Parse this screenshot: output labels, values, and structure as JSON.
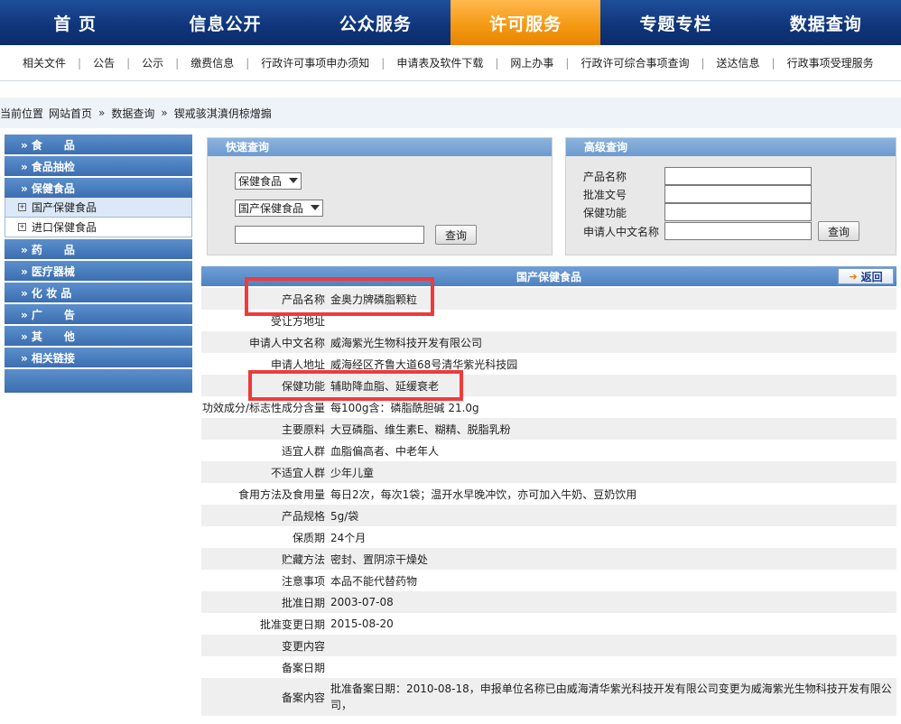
{
  "topnav": [
    {
      "label": "首 页",
      "active": false
    },
    {
      "label": "信息公开",
      "active": false
    },
    {
      "label": "公众服务",
      "active": false
    },
    {
      "label": "许可服务",
      "active": true
    },
    {
      "label": "专题专栏",
      "active": false
    },
    {
      "label": "数据查询",
      "active": false
    }
  ],
  "subnav": [
    "相关文件",
    "公告",
    "公示",
    "缴费信息",
    "行政许可事项申办须知",
    "申请表及软件下载",
    "网上办事",
    "行政许可综合事项查询",
    "送达信息",
    "行政事项受理服务"
  ],
  "breadcrumb": {
    "prefix": "当前位置",
    "items": [
      "网站首页",
      "数据查询",
      "锲戒骇淇濆仴椋熷搧"
    ]
  },
  "sidebar": {
    "items": [
      {
        "label": "» 食　　品",
        "type": "cat"
      },
      {
        "label": "» 食品抽检",
        "type": "cat"
      },
      {
        "label": "» 保健食品",
        "type": "cat"
      },
      {
        "label": "国产保健食品",
        "type": "sub",
        "selected": true
      },
      {
        "label": "进口保健食品",
        "type": "sub",
        "selected": false
      },
      {
        "label": "» 药　　品",
        "type": "cat"
      },
      {
        "label": "» 医疗器械",
        "type": "cat"
      },
      {
        "label": "» 化 妆 品",
        "type": "cat"
      },
      {
        "label": "» 广　　告",
        "type": "cat"
      },
      {
        "label": "» 其　　他",
        "type": "cat"
      },
      {
        "label": "» 相关链接",
        "type": "cat"
      }
    ]
  },
  "quick": {
    "title": "快速查询",
    "select1": "保健食品",
    "select2": "国产保健食品",
    "input": "",
    "button": "查询"
  },
  "advanced": {
    "title": "高级查询",
    "fields": [
      "产品名称",
      "批准文号",
      "保健功能",
      "申请人中文名称"
    ],
    "button": "查询"
  },
  "detail": {
    "title": "国产保健食品",
    "back": "返回",
    "rows": [
      {
        "k": "产品名称",
        "v": "金奥力牌磷脂颗粒"
      },
      {
        "k": "受让方地址",
        "v": ""
      },
      {
        "k": "申请人中文名称",
        "v": "威海紫光生物科技开发有限公司"
      },
      {
        "k": "申请人地址",
        "v": "威海经区齐鲁大道68号清华紫光科技园"
      },
      {
        "k": "保健功能",
        "v": "辅助降血脂、延缓衰老"
      },
      {
        "k": "功效成分/标志性成分含量",
        "v": "每100g含：磷脂酰胆碱 21.0g"
      },
      {
        "k": "主要原料",
        "v": "大豆磷脂、维生素E、糊精、脱脂乳粉"
      },
      {
        "k": "适宜人群",
        "v": "血脂偏高者、中老年人"
      },
      {
        "k": "不适宜人群",
        "v": "少年儿童"
      },
      {
        "k": "食用方法及食用量",
        "v": "每日2次，每次1袋；温开水早晚冲饮，亦可加入牛奶、豆奶饮用"
      },
      {
        "k": "产品规格",
        "v": "5g/袋"
      },
      {
        "k": "保质期",
        "v": "24个月"
      },
      {
        "k": "贮藏方法",
        "v": "密封、置阴凉干燥处"
      },
      {
        "k": "注意事项",
        "v": "本品不能代替药物"
      },
      {
        "k": "批准日期",
        "v": "2003-07-08"
      },
      {
        "k": "批准变更日期",
        "v": "2015-08-20"
      },
      {
        "k": "变更内容",
        "v": ""
      },
      {
        "k": "备案日期",
        "v": ""
      },
      {
        "k": "备案内容",
        "v": "批准备案日期：2010-08-18，申报单位名称已由威海清华紫光科技开发有限公司变更为威海紫光生物科技开发有限公司，"
      }
    ]
  },
  "colors": {
    "accent": "#f59a14",
    "nav": "#0f3479",
    "highlight": "#ee3b3b"
  }
}
